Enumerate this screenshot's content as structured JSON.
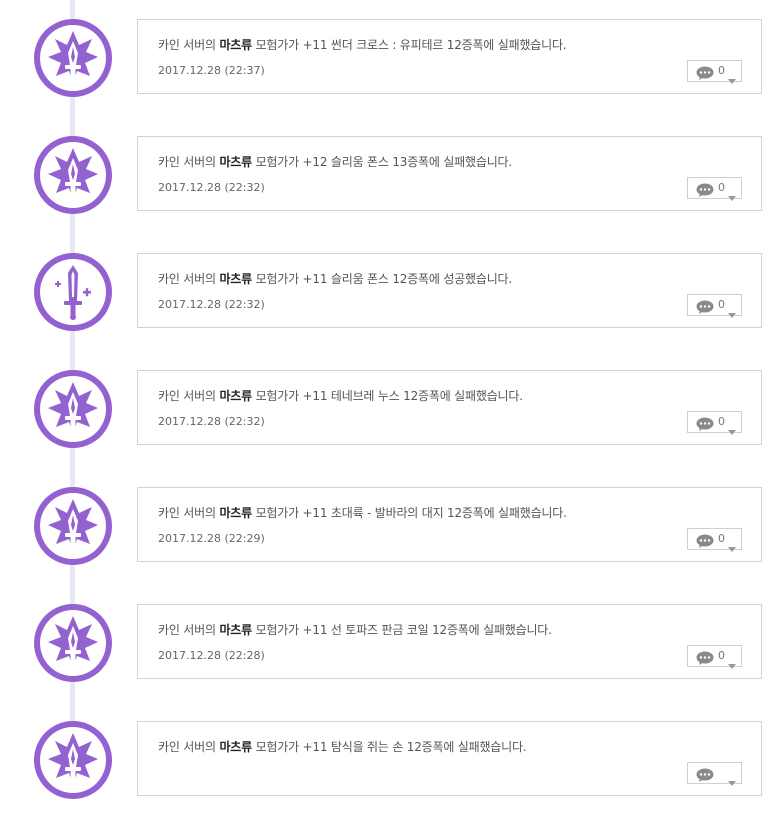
{
  "colors": {
    "avatar_purple": "#9461d1",
    "timeline_line": "#e6e9f2",
    "card_border": "#d3d3d3"
  },
  "entries": [
    {
      "icon": "fail-sword-icon",
      "prefix": "카인 서버의 ",
      "character": "마츠류",
      "message": " 모험가가 +11 썬더 크로스 : 유피테르 12증폭에 실패했습니다.",
      "time": "2017.12.28 (22:37)",
      "comments": "0"
    },
    {
      "icon": "fail-sword-icon",
      "prefix": "카인 서버의 ",
      "character": "마츠류",
      "message": " 모험가가 +12 슬리움 폰스 13증폭에 실패했습니다.",
      "time": "2017.12.28 (22:32)",
      "comments": "0"
    },
    {
      "icon": "success-sword-icon",
      "prefix": "카인 서버의 ",
      "character": "마츠류",
      "message": " 모험가가 +11 슬리움 폰스 12증폭에 성공했습니다.",
      "time": "2017.12.28 (22:32)",
      "comments": "0"
    },
    {
      "icon": "fail-sword-icon",
      "prefix": "카인 서버의 ",
      "character": "마츠류",
      "message": " 모험가가 +11 테네브레 누스 12증폭에 실패했습니다.",
      "time": "2017.12.28 (22:32)",
      "comments": "0"
    },
    {
      "icon": "fail-sword-icon",
      "prefix": "카인 서버의 ",
      "character": "마츠류",
      "message": " 모험가가 +11 초대륙 - 발바라의 대지 12증폭에 실패했습니다.",
      "time": "2017.12.28 (22:29)",
      "comments": "0"
    },
    {
      "icon": "fail-sword-icon",
      "prefix": "카인 서버의 ",
      "character": "마츠류",
      "message": " 모험가가 +11 선 토파즈 판금 코일 12증폭에 실패했습니다.",
      "time": "2017.12.28 (22:28)",
      "comments": "0"
    },
    {
      "icon": "fail-sword-icon",
      "prefix": "카인 서버의 ",
      "character": "마츠류",
      "message": " 모험가가 +11 탐식을 쥐는 손 12증폭에 실패했습니다.",
      "time": "",
      "comments": ""
    }
  ]
}
